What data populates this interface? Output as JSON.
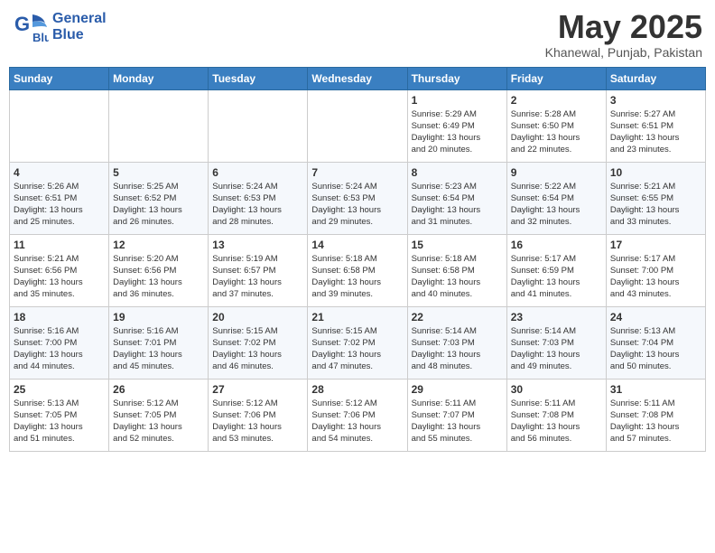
{
  "logo": {
    "line1": "General",
    "line2": "Blue"
  },
  "title": "May 2025",
  "subtitle": "Khanewal, Punjab, Pakistan",
  "days_of_week": [
    "Sunday",
    "Monday",
    "Tuesday",
    "Wednesday",
    "Thursday",
    "Friday",
    "Saturday"
  ],
  "weeks": [
    [
      {
        "num": "",
        "info": ""
      },
      {
        "num": "",
        "info": ""
      },
      {
        "num": "",
        "info": ""
      },
      {
        "num": "",
        "info": ""
      },
      {
        "num": "1",
        "info": "Sunrise: 5:29 AM\nSunset: 6:49 PM\nDaylight: 13 hours\nand 20 minutes."
      },
      {
        "num": "2",
        "info": "Sunrise: 5:28 AM\nSunset: 6:50 PM\nDaylight: 13 hours\nand 22 minutes."
      },
      {
        "num": "3",
        "info": "Sunrise: 5:27 AM\nSunset: 6:51 PM\nDaylight: 13 hours\nand 23 minutes."
      }
    ],
    [
      {
        "num": "4",
        "info": "Sunrise: 5:26 AM\nSunset: 6:51 PM\nDaylight: 13 hours\nand 25 minutes."
      },
      {
        "num": "5",
        "info": "Sunrise: 5:25 AM\nSunset: 6:52 PM\nDaylight: 13 hours\nand 26 minutes."
      },
      {
        "num": "6",
        "info": "Sunrise: 5:24 AM\nSunset: 6:53 PM\nDaylight: 13 hours\nand 28 minutes."
      },
      {
        "num": "7",
        "info": "Sunrise: 5:24 AM\nSunset: 6:53 PM\nDaylight: 13 hours\nand 29 minutes."
      },
      {
        "num": "8",
        "info": "Sunrise: 5:23 AM\nSunset: 6:54 PM\nDaylight: 13 hours\nand 31 minutes."
      },
      {
        "num": "9",
        "info": "Sunrise: 5:22 AM\nSunset: 6:54 PM\nDaylight: 13 hours\nand 32 minutes."
      },
      {
        "num": "10",
        "info": "Sunrise: 5:21 AM\nSunset: 6:55 PM\nDaylight: 13 hours\nand 33 minutes."
      }
    ],
    [
      {
        "num": "11",
        "info": "Sunrise: 5:21 AM\nSunset: 6:56 PM\nDaylight: 13 hours\nand 35 minutes."
      },
      {
        "num": "12",
        "info": "Sunrise: 5:20 AM\nSunset: 6:56 PM\nDaylight: 13 hours\nand 36 minutes."
      },
      {
        "num": "13",
        "info": "Sunrise: 5:19 AM\nSunset: 6:57 PM\nDaylight: 13 hours\nand 37 minutes."
      },
      {
        "num": "14",
        "info": "Sunrise: 5:18 AM\nSunset: 6:58 PM\nDaylight: 13 hours\nand 39 minutes."
      },
      {
        "num": "15",
        "info": "Sunrise: 5:18 AM\nSunset: 6:58 PM\nDaylight: 13 hours\nand 40 minutes."
      },
      {
        "num": "16",
        "info": "Sunrise: 5:17 AM\nSunset: 6:59 PM\nDaylight: 13 hours\nand 41 minutes."
      },
      {
        "num": "17",
        "info": "Sunrise: 5:17 AM\nSunset: 7:00 PM\nDaylight: 13 hours\nand 43 minutes."
      }
    ],
    [
      {
        "num": "18",
        "info": "Sunrise: 5:16 AM\nSunset: 7:00 PM\nDaylight: 13 hours\nand 44 minutes."
      },
      {
        "num": "19",
        "info": "Sunrise: 5:16 AM\nSunset: 7:01 PM\nDaylight: 13 hours\nand 45 minutes."
      },
      {
        "num": "20",
        "info": "Sunrise: 5:15 AM\nSunset: 7:02 PM\nDaylight: 13 hours\nand 46 minutes."
      },
      {
        "num": "21",
        "info": "Sunrise: 5:15 AM\nSunset: 7:02 PM\nDaylight: 13 hours\nand 47 minutes."
      },
      {
        "num": "22",
        "info": "Sunrise: 5:14 AM\nSunset: 7:03 PM\nDaylight: 13 hours\nand 48 minutes."
      },
      {
        "num": "23",
        "info": "Sunrise: 5:14 AM\nSunset: 7:03 PM\nDaylight: 13 hours\nand 49 minutes."
      },
      {
        "num": "24",
        "info": "Sunrise: 5:13 AM\nSunset: 7:04 PM\nDaylight: 13 hours\nand 50 minutes."
      }
    ],
    [
      {
        "num": "25",
        "info": "Sunrise: 5:13 AM\nSunset: 7:05 PM\nDaylight: 13 hours\nand 51 minutes."
      },
      {
        "num": "26",
        "info": "Sunrise: 5:12 AM\nSunset: 7:05 PM\nDaylight: 13 hours\nand 52 minutes."
      },
      {
        "num": "27",
        "info": "Sunrise: 5:12 AM\nSunset: 7:06 PM\nDaylight: 13 hours\nand 53 minutes."
      },
      {
        "num": "28",
        "info": "Sunrise: 5:12 AM\nSunset: 7:06 PM\nDaylight: 13 hours\nand 54 minutes."
      },
      {
        "num": "29",
        "info": "Sunrise: 5:11 AM\nSunset: 7:07 PM\nDaylight: 13 hours\nand 55 minutes."
      },
      {
        "num": "30",
        "info": "Sunrise: 5:11 AM\nSunset: 7:08 PM\nDaylight: 13 hours\nand 56 minutes."
      },
      {
        "num": "31",
        "info": "Sunrise: 5:11 AM\nSunset: 7:08 PM\nDaylight: 13 hours\nand 57 minutes."
      }
    ]
  ]
}
